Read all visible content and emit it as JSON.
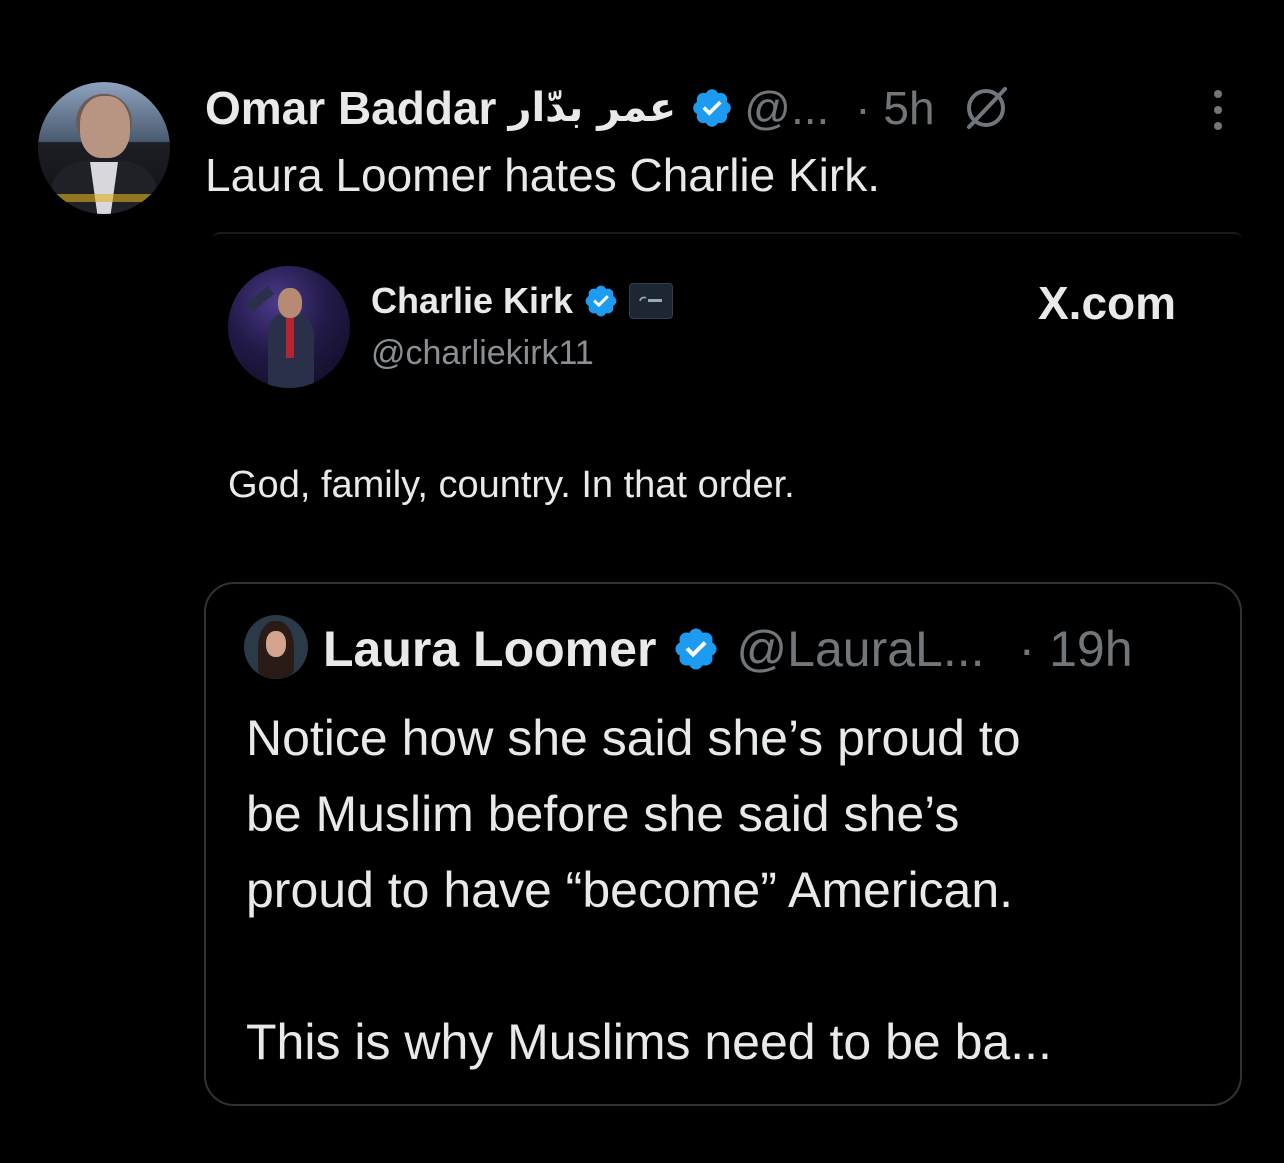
{
  "tweet": {
    "author_name": "Omar Baddar",
    "author_name_arabic": "عمر بدّار",
    "handle": "@...",
    "time": "· 5h",
    "text": "Laura Loomer hates Charlie Kirk."
  },
  "card": {
    "name": "Charlie Kirk",
    "handle": "@charliekirk11",
    "site": "X.com",
    "text": "God, family, country. In that order."
  },
  "quoted": {
    "name": "Laura Loomer",
    "handle": "@LauraL...",
    "time": "· 19h",
    "lines": [
      "Notice how she said she’s proud to",
      "be Muslim before she said she’s",
      "proud to have “become” American.",
      "This is why Muslims need to be ba..."
    ]
  },
  "colors": {
    "background": "#000000",
    "text": "#e7e9ea",
    "muted": "#71767b",
    "verified": "#1d9bf0",
    "border": "#2f3336"
  }
}
